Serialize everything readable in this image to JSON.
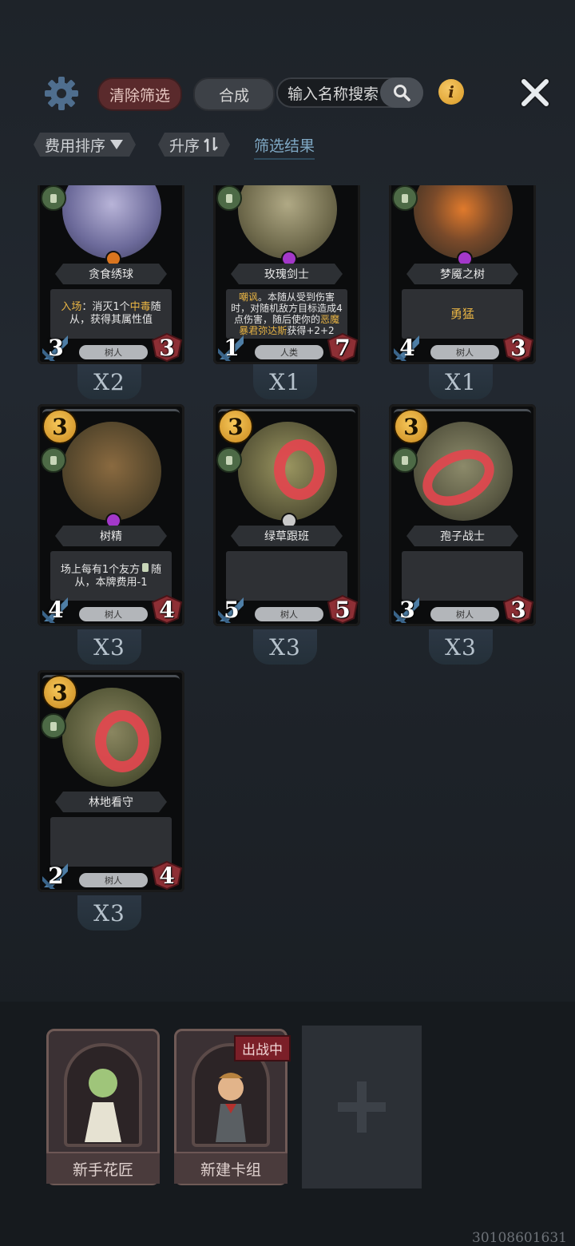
{
  "toolbar": {
    "clear_filter": "清除筛选",
    "merge": "合成",
    "search_placeholder": "输入名称搜索",
    "info": "i"
  },
  "filters": {
    "sort_by": "费用排序",
    "order": "升序",
    "result": "筛选结果"
  },
  "cards": [
    {
      "name": "贪食绣球",
      "cost": "",
      "attack": "3",
      "health": "3",
      "race": "树人",
      "count": "X2",
      "gem": "#d9751f",
      "text_parts": [
        [
          "入场",
          "hl"
        ],
        [
          "：消灭1个",
          ""
        ],
        [
          "中毒",
          "hl"
        ],
        [
          "随从，获得其属性值",
          ""
        ]
      ]
    },
    {
      "name": "玫瑰剑士",
      "cost": "",
      "attack": "1",
      "health": "7",
      "race": "人类",
      "count": "X1",
      "gem": "#a338c9",
      "text_parts": [
        [
          "嘲讽",
          "hl"
        ],
        [
          "。本随从受到伤害时，对随机敌方目标造成4点伤害，随后使你的",
          ""
        ],
        [
          "恶魔暴君弥达斯",
          "hl"
        ],
        [
          "获得+2+2",
          ""
        ]
      ]
    },
    {
      "name": "梦魇之树",
      "cost": "",
      "attack": "4",
      "health": "3",
      "race": "树人",
      "count": "X1",
      "gem": "#a338c9",
      "text_parts": [
        [
          "勇猛",
          "hl"
        ]
      ]
    },
    {
      "name": "树精",
      "cost": "3",
      "attack": "4",
      "health": "4",
      "race": "树人",
      "count": "X3",
      "gem": "#a338c9",
      "text_parts": [
        [
          "场上每有1个友方",
          ""
        ],
        [
          "随从，本牌费用-1",
          ""
        ]
      ]
    },
    {
      "name": "绿草跟班",
      "cost": "3",
      "attack": "5",
      "health": "5",
      "race": "树人",
      "count": "X3",
      "gem": "#c9c9c9",
      "text_parts": []
    },
    {
      "name": "孢子战士",
      "cost": "3",
      "attack": "3",
      "health": "3",
      "race": "树人",
      "count": "X3",
      "gem": "",
      "text_parts": []
    },
    {
      "name": "林地看守",
      "cost": "3",
      "attack": "2",
      "health": "4",
      "race": "树人",
      "count": "X3",
      "gem": "",
      "text_parts": []
    }
  ],
  "decks": [
    {
      "name": "新手花匠",
      "badge": ""
    },
    {
      "name": "新建卡组",
      "badge": "出战中"
    }
  ],
  "watermark": "30108601631",
  "colors": {
    "accent_gold": "#e8b444",
    "clear_red": "#5a2a2c",
    "scribble_red": "#e2464e"
  },
  "icons": [
    "gear-icon",
    "search-icon",
    "info-icon",
    "close-icon",
    "filter-triangle-icon",
    "sort-arrows-icon",
    "tree-tribe-icon",
    "plus-icon"
  ]
}
